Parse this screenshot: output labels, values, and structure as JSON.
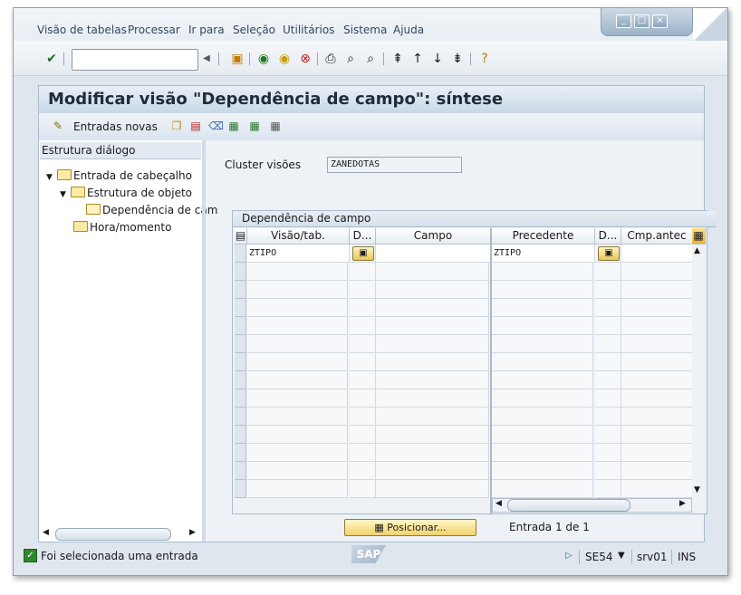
{
  "menu": {
    "items": [
      "Visão de tabelas",
      "Processar",
      "Ir para",
      "Seleção",
      "Utilitários",
      "Sistema",
      "Ajuda"
    ]
  },
  "toolbar": {
    "command_field": "",
    "icons": [
      "enter-icon",
      "save-icon",
      "back-icon",
      "exit-icon",
      "cancel-icon",
      "print-icon",
      "find-icon",
      "find-next-icon",
      "first-page-icon",
      "prev-page-icon",
      "next-page-icon",
      "last-page-icon",
      "help-icon"
    ]
  },
  "title": "Modificar visão \"Dependência de campo\": síntese",
  "app_toolbar": {
    "new_entries_label": "Entradas novas"
  },
  "nav": {
    "header": "Estrutura diálogo",
    "items": [
      {
        "label": "Entrada de cabeçalho",
        "level": 1,
        "expanded": true
      },
      {
        "label": "Estrutura de objeto",
        "level": 2,
        "expanded": true
      },
      {
        "label": "Dependência de cam",
        "level": 3,
        "open": true
      },
      {
        "label": "Hora/momento",
        "level": 1
      }
    ]
  },
  "cluster": {
    "label": "Cluster visões",
    "value": "ZANEDOTAS"
  },
  "table": {
    "title": "Dependência de campo",
    "left_columns": [
      "Visão/tab.",
      "D...",
      "Campo"
    ],
    "right_columns": [
      "Precedente",
      "D...",
      "Cmp.antec"
    ],
    "rows": [
      {
        "view_tab": "ZTIPO",
        "field": "",
        "preceding": "ZTIPO",
        "prev_field": ""
      }
    ],
    "empty_rows": 13
  },
  "position_button": "Posicionar...",
  "entry_text": "Entrada 1 de 1",
  "status": {
    "message": "Foi selecionada uma entrada",
    "transaction": "SE54",
    "server": "srv01",
    "mode": "INS",
    "logo": "SAP"
  }
}
